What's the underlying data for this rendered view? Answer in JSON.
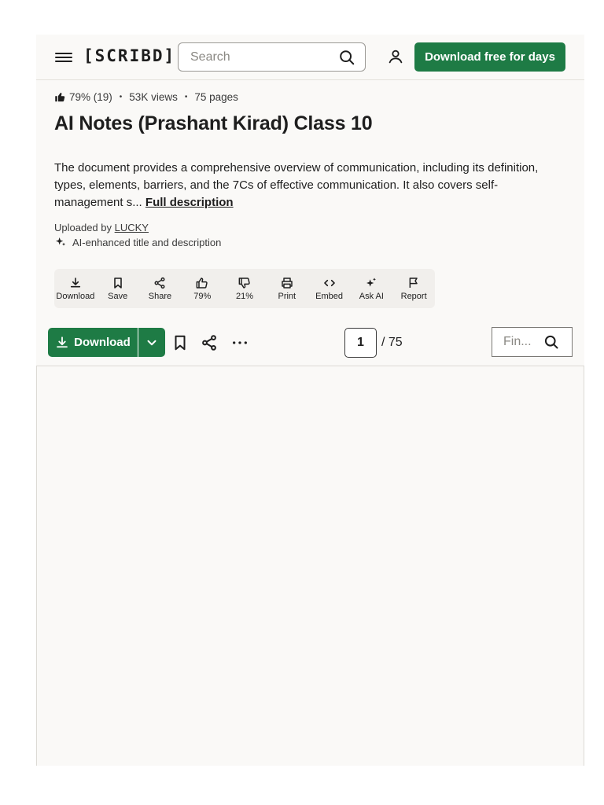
{
  "header": {
    "logo": "[SCRIBD]",
    "search_placeholder": "Search",
    "cta_label": "Download free for days"
  },
  "meta": {
    "rating": "79% (19)",
    "views": "53K views",
    "pages": "75 pages"
  },
  "document": {
    "title": "AI Notes (Prashant Kirad) Class 10",
    "description": "The document provides a comprehensive overview of communication, including its definition, types, elements, barriers, and the 7Cs of effective communication. It also covers self-management s...",
    "full_description_link": "Full description",
    "uploaded_by_label": "Uploaded by",
    "uploader": "LUCKY",
    "ai_note": "AI-enhanced title and description"
  },
  "actions": [
    {
      "label": "Download",
      "icon": "download-icon"
    },
    {
      "label": "Save",
      "icon": "bookmark-icon"
    },
    {
      "label": "Share",
      "icon": "share-icon"
    },
    {
      "label": "79%",
      "icon": "thumbs-up-icon"
    },
    {
      "label": "21%",
      "icon": "thumbs-down-icon"
    },
    {
      "label": "Print",
      "icon": "print-icon"
    },
    {
      "label": "Embed",
      "icon": "embed-icon"
    },
    {
      "label": "Ask AI",
      "icon": "sparkle-icon"
    },
    {
      "label": "Report",
      "icon": "flag-icon"
    }
  ],
  "toolbar": {
    "download_label": "Download",
    "current_page": "1",
    "total_pages": "/ 75",
    "find_placeholder": "Fin..."
  },
  "colors": {
    "brand_green": "#1e7b45",
    "page_bg": "#faf9f7",
    "action_bar_bg": "#f1efec"
  }
}
